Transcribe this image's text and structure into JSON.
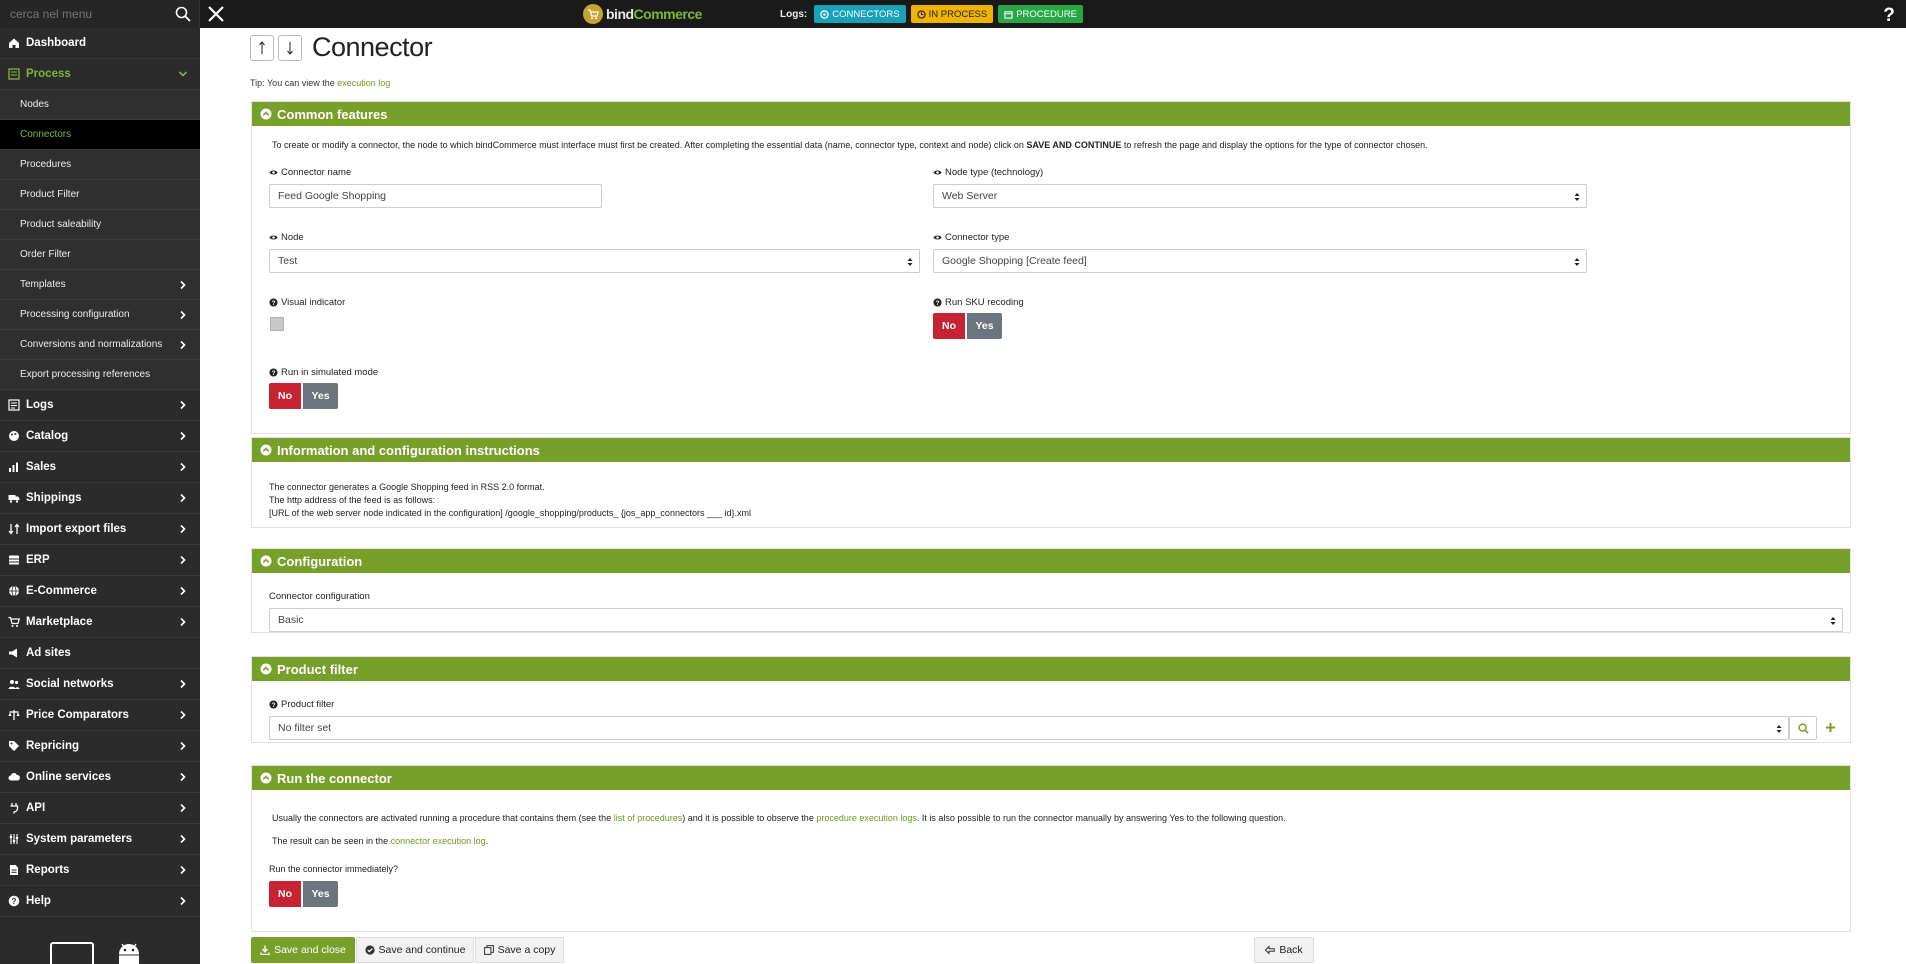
{
  "topbar": {
    "search_placeholder": "cerca nel menu",
    "logo_part1": "bind",
    "logo_part2": "Commerce",
    "logs_label": "Logs:",
    "log_connectors": "CONNECTORS",
    "log_in_process": "IN PROCESS",
    "log_procedure": "PROCEDURE"
  },
  "sidebar": {
    "dashboard": "Dashboard",
    "process": "Process",
    "process_sub": {
      "nodes": "Nodes",
      "connectors": "Connectors",
      "procedures": "Procedures",
      "product_filter": "Product Filter",
      "product_saleability": "Product saleability",
      "order_filter": "Order Filter",
      "templates": "Templates",
      "processing_configuration": "Processing configuration",
      "conversions": "Conversions and normalizations",
      "export_refs": "Export processing references"
    },
    "logs": "Logs",
    "catalog": "Catalog",
    "sales": "Sales",
    "shippings": "Shippings",
    "import_export": "Import export files",
    "erp": "ERP",
    "ecommerce": "E-Commerce",
    "marketplace": "Marketplace",
    "ad_sites": "Ad sites",
    "social": "Social networks",
    "price_comparators": "Price Comparators",
    "repricing": "Repricing",
    "online_services": "Online services",
    "api": "API",
    "system_parameters": "System parameters",
    "reports": "Reports",
    "help": "Help"
  },
  "page": {
    "title": "Connector",
    "tip_prefix": "Tip: You can view the ",
    "tip_link": "execution log"
  },
  "common": {
    "heading": "Common features",
    "intro_a": "To create or modify a connector, the node to which bindCommerce must interface must first be created. After completing the essential data (name, connector type, context and node) click on ",
    "intro_strong": "SAVE AND CONTINUE",
    "intro_b": " to refresh the page and display the options for the type of connector chosen.",
    "connector_name_label": "Connector name",
    "connector_name_value": "Feed Google Shopping",
    "node_type_label": "Node type (technology)",
    "node_type_value": "Web Server",
    "node_label": "Node",
    "node_value": "Test",
    "connector_type_label": "Connector type",
    "connector_type_value": "Google Shopping [Create feed]",
    "visual_indicator_label": "Visual indicator",
    "run_sku_label": "Run SKU recoding",
    "run_simulated_label": "Run in simulated mode",
    "no": "No",
    "yes": "Yes"
  },
  "info": {
    "heading": "Information and configuration instructions",
    "line1": "The connector generates a Google Shopping feed in RSS 2.0 format.",
    "line2": "The http address of the feed is as follows:",
    "line3": "[URL of the web server node indicated in the configuration] /google_shopping/products_ {jos_app_connectors ___ id}.xml"
  },
  "configuration": {
    "heading": "Configuration",
    "label": "Connector configuration",
    "value": "Basic"
  },
  "product_filter": {
    "heading": "Product filter",
    "label": "Product filter",
    "value": "No filter set"
  },
  "run": {
    "heading": "Run the connector",
    "p1_a": "Usually the connectors are activated running a procedure that contains them (see the ",
    "p1_link1": "list of procedures",
    "p1_b": ") and it is possible to observe the ",
    "p1_link2": "procedure execution logs",
    "p1_c": ". It is also possible to run the connector manually by answering Yes to the following question.",
    "p2_a": "The result can be seen in the ",
    "p2_link": "connector execution log",
    "p2_b": ".",
    "question": "Run the connector immediately?"
  },
  "footer": {
    "save_close": "Save and close",
    "save_continue": "Save and continue",
    "save_copy": "Save a copy",
    "back": "Back"
  },
  "colors": {
    "accent_green": "#76a02a",
    "danger_red": "#c82333",
    "secondary_gray": "#6c757d",
    "info_cyan": "#17a2b8",
    "warning_yellow": "#f0b400"
  }
}
